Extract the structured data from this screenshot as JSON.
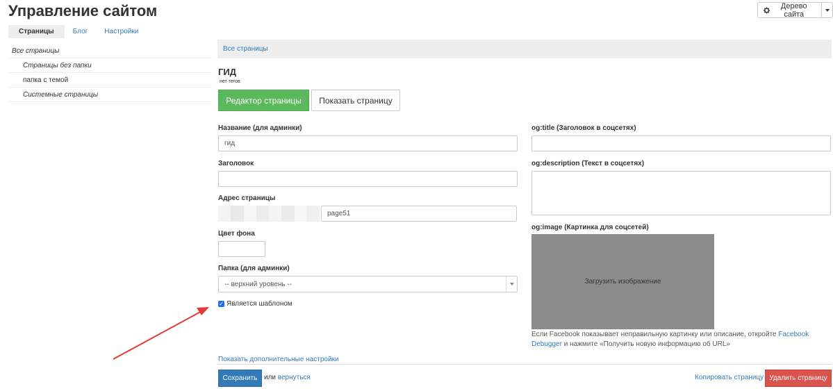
{
  "header": {
    "title": "Управление сайтом",
    "tree_button": "Дерево сайта",
    "gear_icon": "gear-icon",
    "caret_icon": "caret-down-icon"
  },
  "tabs": [
    {
      "label": "Страницы",
      "active": true
    },
    {
      "label": "Блог",
      "active": false
    },
    {
      "label": "Настройки",
      "active": false
    }
  ],
  "sidebar": {
    "items": [
      {
        "label": "Все страницы"
      },
      {
        "label": "Страницы без папки"
      },
      {
        "label": "папка с темой"
      },
      {
        "label": "Системные страницы"
      }
    ]
  },
  "breadcrumb": "Все страницы",
  "page": {
    "name": "ГИД",
    "tags": "нет тегов",
    "editor_button": "Редактор страницы",
    "show_button": "Показать страницу"
  },
  "form": {
    "admin_name_label": "Название (для админки)",
    "admin_name_value": "гид",
    "title_label": "Заголовок",
    "title_value": "",
    "address_label": "Адрес страницы",
    "address_value": "page51",
    "bg_color_label": "Цвет фона",
    "bg_color_value": "",
    "folder_label": "Папка (для админки)",
    "folder_value": "-- верхний уровень --",
    "template_label": "Является шаблоном",
    "template_checked": true,
    "more_settings": "Показать дополнительные настройки"
  },
  "og": {
    "title_label": "og:title (Заголовок в соцсетях)",
    "title_value": "",
    "description_label": "og:description (Текст в соцсетях)",
    "description_value": "",
    "image_label": "og:image (Картинка для соцсетей)",
    "upload_label": "Загрузить изображение",
    "note_before": "Если Facebook показывает неправильную картинку или описание, откройте ",
    "note_link": "Facebook Debugger",
    "note_after": " и нажмите «Получить новую информацию об URL»"
  },
  "footer": {
    "save_button": "Сохранить",
    "or_text": "или",
    "back_link": "вернуться",
    "copy_link": "Копировать страницу",
    "delete_button": "Удалить страницу"
  },
  "colors": {
    "primary": "#337ab7",
    "success": "#5cb85c",
    "danger": "#d9534f",
    "arrow": "#e53935",
    "upload_bg": "#8c8c8c"
  }
}
